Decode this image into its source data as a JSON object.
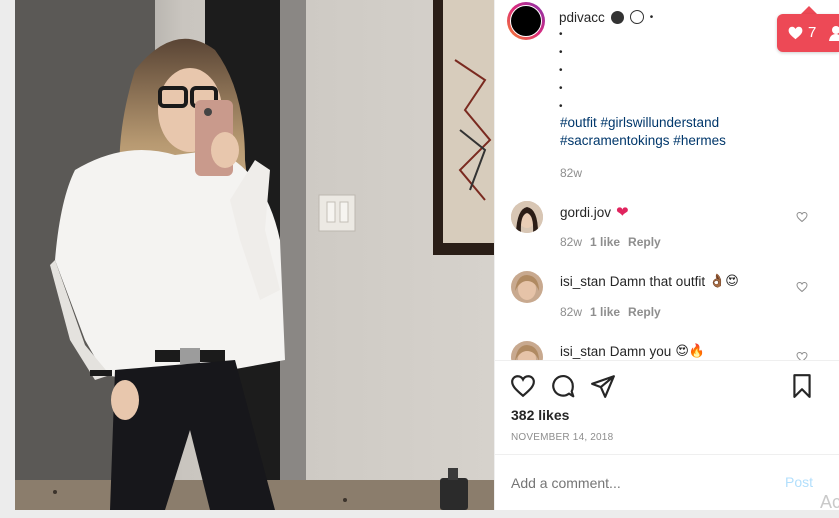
{
  "post": {
    "username": "pdivacc",
    "caption_dots": [
      "•",
      "•",
      "•",
      "•",
      "•"
    ],
    "hashtags_line1": "#outfit #girlswillunderstand",
    "hashtags_line2": "#sacramentokings #hermes",
    "caption_time": "82w"
  },
  "comments": [
    {
      "username": "gordi.jov",
      "text": "",
      "emoji": "❤",
      "time": "82w",
      "likes": "1 like",
      "reply": "Reply"
    },
    {
      "username": "isi_stan",
      "text": "Damn that outfit",
      "emoji": "👌🏾😍",
      "time": "82w",
      "likes": "1 like",
      "reply": "Reply"
    },
    {
      "username": "isi_stan",
      "text": "Damn you",
      "emoji": "😍🔥",
      "time": "",
      "likes": "",
      "reply": ""
    }
  ],
  "actions": {
    "likes": "382 likes",
    "date": "NOVEMBER 14, 2018"
  },
  "add_comment": {
    "placeholder": "Add a comment...",
    "post_label": "Post"
  },
  "notification": {
    "count": "7"
  },
  "watermark": "Ac",
  "colors": {
    "accent_link": "#00376b",
    "notification_red": "#ed4956",
    "post_button_disabled": "#b2dffc"
  }
}
